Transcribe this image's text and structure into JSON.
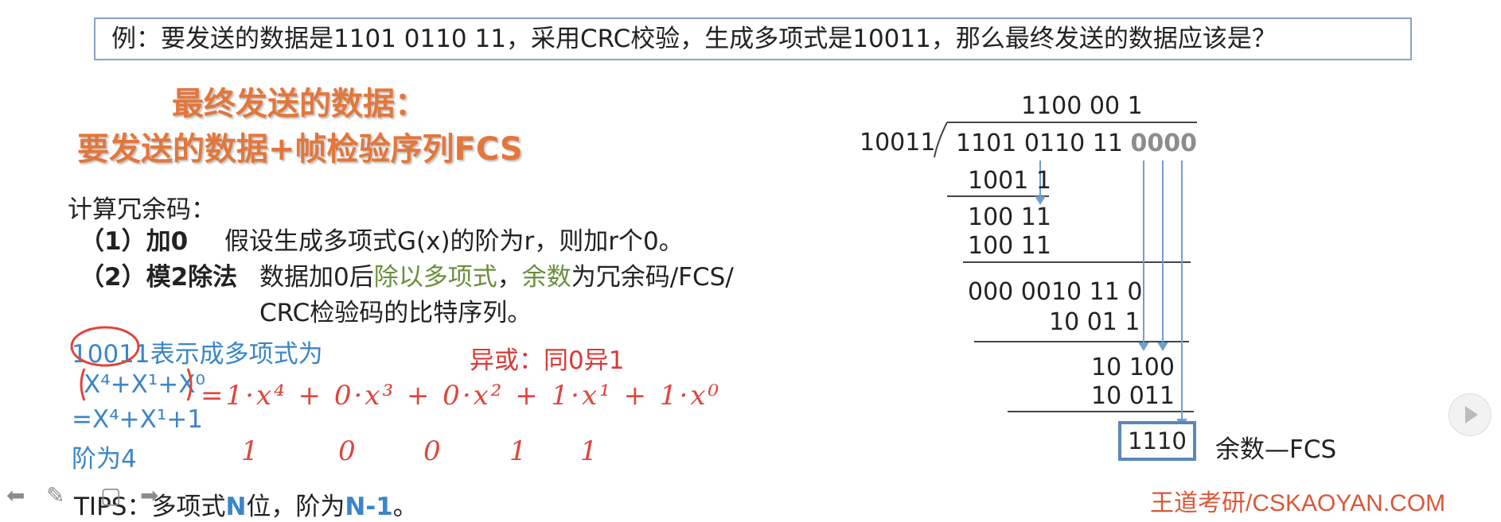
{
  "question": "例：要发送的数据是1101 0110 11，采用CRC校验，生成多项式是10011，那么最终发送的数据应该是？",
  "heading": {
    "line1": "最终发送的数据：",
    "line2": "要发送的数据+帧检验序列FCS"
  },
  "calc": {
    "title": "计算冗余码：",
    "step1_label": "（1）加0",
    "step1_text": "假设生成多项式G(x)的阶为r，则加r个0。",
    "step2_label": "（2）模2除法",
    "step2_text_a": "数据加0后",
    "step2_text_b": "除以多项式",
    "step2_text_c": "，",
    "step2_text_d": "余数",
    "step2_text_e": "为冗余码/FCS/",
    "step2_text_line2": "CRC检验码的比特序列。"
  },
  "notes": {
    "poly_line1": "10011表示成多项式为",
    "poly_line2": "X⁴+X¹+X⁰",
    "poly_line3": "=X⁴+X¹+1",
    "poly_line4": "阶为4",
    "xor": "异或：同0异1",
    "hand_expr": "=1·x⁴ + 0·x³ + 0·x² + 1·x¹ + 1·x⁰",
    "hand_bits": [
      "1",
      "0",
      "0",
      "1",
      "1"
    ]
  },
  "tips": {
    "prefix": "TIPS：",
    "text_a": "多项式",
    "text_b": "N",
    "text_c": "位，阶为",
    "text_d": "N-1",
    "text_e": "。"
  },
  "division": {
    "quotient": "1100 00 1",
    "divisor": "10011",
    "dividend": "1101 0110 11",
    "appended_zeros": "0000",
    "rows": [
      "1001 1",
      "100 11",
      "100 11",
      "000 0010 11  0",
      "10 01 1",
      "10 100",
      "10 011"
    ],
    "remainder": "1110",
    "remainder_label": "余数—FCS"
  },
  "footer": {
    "brand": "王道考研/CSKAOYAN.COM"
  },
  "colors": {
    "heading": "#e2773c",
    "blue": "#3a86c8",
    "red": "#d93a36",
    "green": "#6b8e3d",
    "box": "#5b87b8"
  }
}
